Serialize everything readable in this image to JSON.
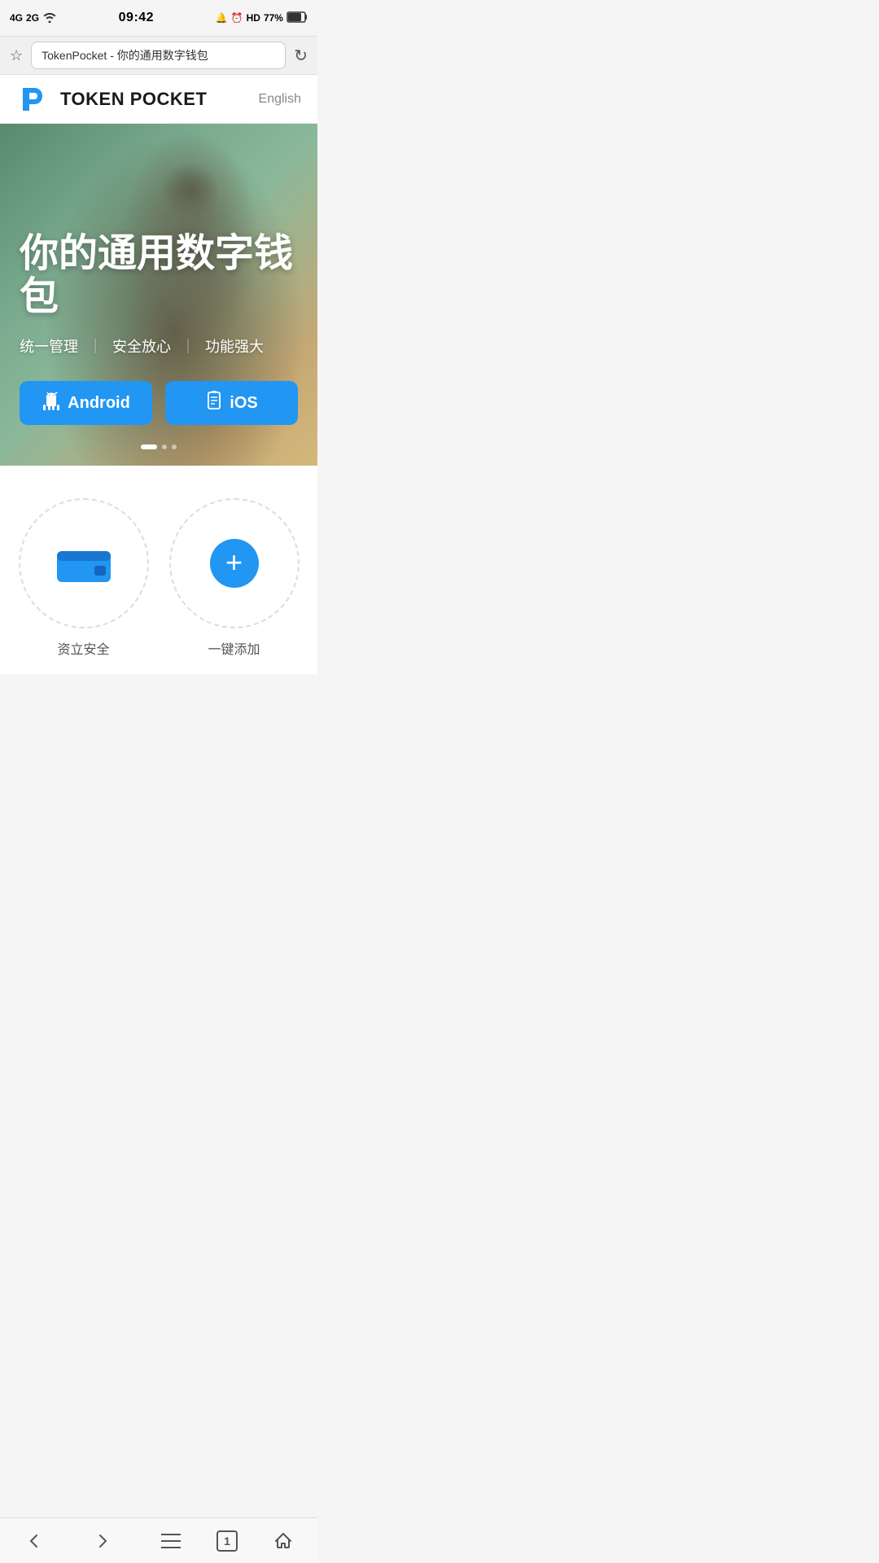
{
  "statusBar": {
    "network": "4G ‧ 2G",
    "signal1": "4G",
    "signal2": "2G",
    "wifi": "WiFi",
    "time": "09:42",
    "battery": "77%",
    "batteryIcon": "🔋"
  },
  "browser": {
    "tabTitle": "TokenPocket - 你的通用数字钱包",
    "reloadIcon": "↻"
  },
  "header": {
    "logoAlt": "Token Pocket Logo",
    "brandName": "TOKEN POCKET",
    "langButton": "English"
  },
  "hero": {
    "title": "你的通用数字钱包",
    "subtitle": {
      "part1": "统一管理",
      "divider1": "｜",
      "part2": "安全放心",
      "divider2": "｜",
      "part3": "功能强大"
    },
    "androidBtn": "Android",
    "iosBtn": "iOS",
    "androidIcon": "🤖",
    "iosIcon": "📱"
  },
  "features": [
    {
      "id": "wallet",
      "label": "资立安全"
    },
    {
      "id": "add",
      "label": "一键添加"
    }
  ],
  "bottomNav": {
    "back": "‹",
    "forward": "›",
    "menu": "☰",
    "tabCount": "1",
    "home": "⌂"
  },
  "slideIndicator": [
    {
      "active": true
    },
    {
      "active": false
    },
    {
      "active": false
    }
  ]
}
